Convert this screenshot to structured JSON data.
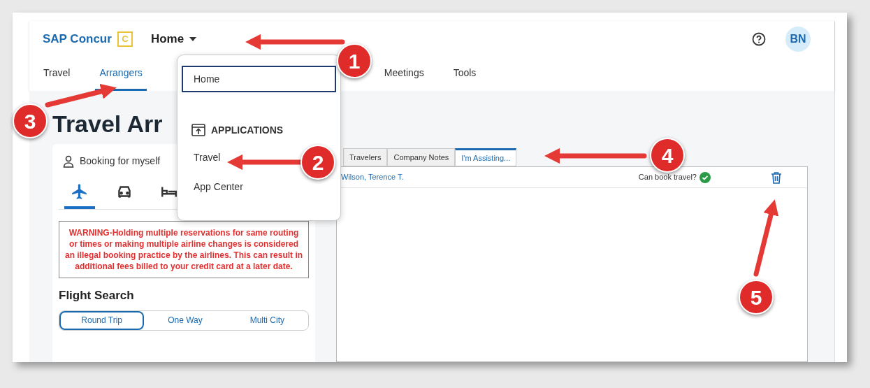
{
  "header": {
    "logo_text": "SAP Concur",
    "logo_mark": "C",
    "menu_label": "Home",
    "avatar": "BN"
  },
  "nav_tabs": [
    {
      "label": "Travel",
      "selected": false
    },
    {
      "label": "Arrangers",
      "selected": true
    },
    {
      "label": "Meetings",
      "selected": false
    },
    {
      "label": "Tools",
      "selected": false
    }
  ],
  "page_title": "Travel Arr",
  "booking": {
    "label": "Booking for myself",
    "modes": [
      {
        "kind": "flight",
        "selected": true
      },
      {
        "kind": "car",
        "selected": false
      },
      {
        "kind": "hotel",
        "selected": false
      }
    ]
  },
  "warning": "WARNING-Holding multiple reservations for same routing or times or making multiple airline changes is considered an illegal booking practice by the airlines. This can result in additional fees billed to your credit card at a later date.",
  "flight_search": {
    "title": "Flight Search",
    "trip_types": [
      {
        "label": "Round Trip",
        "selected": true
      },
      {
        "label": "One Way",
        "selected": false
      },
      {
        "label": "Multi City",
        "selected": false
      }
    ]
  },
  "panel_tabs": [
    {
      "label": "Travelers",
      "selected": false
    },
    {
      "label": "Company Notes",
      "selected": false
    },
    {
      "label": "I'm Assisting...",
      "selected": true
    }
  ],
  "assisting_rows": [
    {
      "name": "Wilson, Terence T.",
      "status": "Can book travel?",
      "can_book": true
    }
  ],
  "dropdown": {
    "items": [
      {
        "kind": "item",
        "label": "Home",
        "selected": true
      },
      {
        "kind": "header",
        "label": "APPLICATIONS"
      },
      {
        "kind": "item",
        "label": "Travel",
        "selected": false
      },
      {
        "kind": "item",
        "label": "App Center",
        "selected": false
      }
    ]
  },
  "annotations": [
    {
      "label": "1"
    },
    {
      "label": "2"
    },
    {
      "label": "3"
    },
    {
      "label": "4"
    },
    {
      "label": "5"
    }
  ]
}
